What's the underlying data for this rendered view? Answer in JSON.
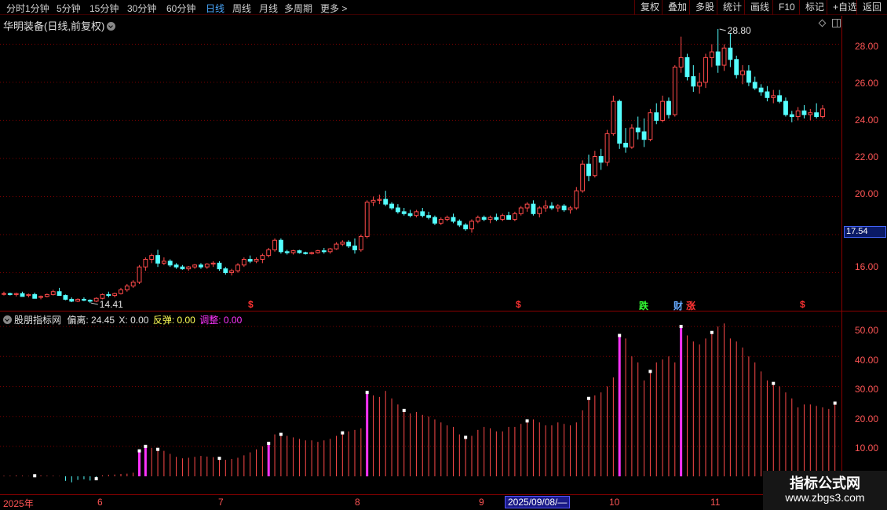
{
  "toolbar": {
    "periods": [
      "分时",
      "1分钟",
      "5分钟",
      "15分钟",
      "30分钟",
      "60分钟",
      "日线",
      "周线",
      "月线",
      "多周期",
      "更多 >"
    ],
    "active_period": "日线",
    "tools": [
      "复权",
      "叠加",
      "多股",
      "统计",
      "画线",
      "F10",
      "标记",
      "+自选",
      "返回"
    ]
  },
  "stock": {
    "title": "华明装备(日线,前复权)",
    "high_marker": "28.80",
    "low_marker": "14.41",
    "current_price": "17.54"
  },
  "price_axis": [
    "28.00",
    "26.00",
    "24.00",
    "22.00",
    "20.00",
    "16.00"
  ],
  "indicator": {
    "name": "股朋指标网",
    "deviation_label": "偏离:",
    "deviation_value": "24.45",
    "x_label": "X:",
    "x_value": "0.00",
    "rebound_label": "反弹:",
    "rebound_value": "0.00",
    "adjust_label": "调整:",
    "adjust_value": "0.00",
    "axis": [
      "50.00",
      "40.00",
      "30.00",
      "20.00",
      "10.00"
    ]
  },
  "events": {
    "dollar": "$",
    "fall": "跌",
    "finance": "财",
    "rise": "涨"
  },
  "date_axis": {
    "labels": [
      "2025年",
      "6",
      "7",
      "8",
      "9",
      "10",
      "11"
    ],
    "cursor": "2025/09/08/—"
  },
  "watermark": {
    "title": "指标公式网",
    "url": "www.zbgs3.com"
  },
  "colors": {
    "up": "#ff4a4a",
    "down": "#54ffff",
    "signal": "#ff33ff",
    "grid": "#7a0000"
  },
  "chart_data": [
    {
      "type": "candlestick",
      "title": "华明装备(日线,前复权)",
      "ylim": [
        14.0,
        29.5
      ],
      "y_ticks": [
        16,
        18,
        20,
        22,
        24,
        26,
        28
      ],
      "x_ticks": [
        "2025年",
        "6",
        "7",
        "8",
        "9",
        "10",
        "11"
      ],
      "ohlc": [
        [
          14.9,
          15.0,
          14.8,
          14.9
        ],
        [
          14.9,
          14.95,
          14.8,
          14.85
        ],
        [
          14.85,
          14.95,
          14.75,
          14.9
        ],
        [
          14.9,
          15.0,
          14.8,
          14.75
        ],
        [
          14.8,
          14.9,
          14.7,
          14.85
        ],
        [
          14.85,
          14.95,
          14.7,
          14.65
        ],
        [
          14.7,
          14.8,
          14.6,
          14.75
        ],
        [
          14.75,
          14.9,
          14.7,
          14.85
        ],
        [
          14.85,
          15.1,
          14.8,
          15.0
        ],
        [
          15.0,
          15.2,
          14.9,
          14.8
        ],
        [
          14.8,
          14.85,
          14.55,
          14.6
        ],
        [
          14.6,
          14.7,
          14.45,
          14.5
        ],
        [
          14.5,
          14.65,
          14.45,
          14.6
        ],
        [
          14.6,
          14.7,
          14.5,
          14.55
        ],
        [
          14.55,
          14.6,
          14.41,
          14.5
        ],
        [
          14.5,
          14.7,
          14.45,
          14.65
        ],
        [
          14.65,
          14.9,
          14.6,
          14.85
        ],
        [
          14.85,
          15.0,
          14.7,
          14.8
        ],
        [
          14.8,
          14.95,
          14.7,
          14.9
        ],
        [
          14.9,
          15.2,
          14.85,
          15.1
        ],
        [
          15.1,
          15.4,
          15.0,
          15.3
        ],
        [
          15.3,
          15.6,
          15.2,
          15.5
        ],
        [
          15.5,
          16.4,
          15.4,
          16.3
        ],
        [
          16.3,
          16.8,
          16.1,
          16.7
        ],
        [
          16.7,
          17.0,
          16.5,
          16.9
        ],
        [
          16.9,
          17.2,
          16.3,
          16.5
        ],
        [
          16.5,
          16.8,
          16.4,
          16.6
        ],
        [
          16.6,
          16.7,
          16.3,
          16.4
        ],
        [
          16.4,
          16.5,
          16.2,
          16.3
        ],
        [
          16.3,
          16.4,
          16.15,
          16.2
        ],
        [
          16.2,
          16.35,
          16.1,
          16.3
        ],
        [
          16.3,
          16.45,
          16.2,
          16.4
        ],
        [
          16.4,
          16.5,
          16.2,
          16.3
        ],
        [
          16.3,
          16.5,
          16.2,
          16.45
        ],
        [
          16.45,
          16.6,
          16.3,
          16.5
        ],
        [
          16.5,
          16.6,
          16.1,
          16.2
        ],
        [
          16.2,
          16.3,
          15.9,
          16.0
        ],
        [
          16.0,
          16.2,
          15.85,
          16.1
        ],
        [
          16.1,
          16.5,
          16.0,
          16.4
        ],
        [
          16.4,
          16.8,
          16.3,
          16.7
        ],
        [
          16.7,
          16.9,
          16.5,
          16.6
        ],
        [
          16.6,
          16.8,
          16.5,
          16.7
        ],
        [
          16.7,
          17.0,
          16.5,
          16.9
        ],
        [
          16.9,
          17.3,
          16.8,
          17.2
        ],
        [
          17.2,
          17.8,
          17.1,
          17.7
        ],
        [
          17.7,
          17.8,
          17.0,
          17.1
        ],
        [
          17.1,
          17.2,
          16.95,
          17.05
        ],
        [
          17.05,
          17.2,
          16.95,
          17.15
        ],
        [
          17.15,
          17.2,
          17.0,
          17.05
        ],
        [
          17.05,
          17.1,
          16.95,
          17.0
        ],
        [
          17.0,
          17.1,
          16.95,
          17.05
        ],
        [
          17.05,
          17.2,
          17.0,
          17.15
        ],
        [
          17.15,
          17.3,
          17.0,
          17.1
        ],
        [
          17.1,
          17.3,
          17.0,
          17.25
        ],
        [
          17.25,
          17.6,
          17.2,
          17.5
        ],
        [
          17.5,
          17.7,
          17.4,
          17.6
        ],
        [
          17.6,
          17.7,
          17.3,
          17.4
        ],
        [
          17.4,
          17.8,
          17.0,
          17.2
        ],
        [
          17.2,
          18.0,
          17.1,
          17.9
        ],
        [
          17.9,
          19.8,
          17.8,
          19.7
        ],
        [
          19.7,
          20.0,
          19.5,
          19.8
        ],
        [
          19.8,
          20.1,
          19.6,
          19.85
        ],
        [
          19.85,
          20.3,
          19.5,
          19.6
        ],
        [
          19.6,
          19.7,
          19.3,
          19.4
        ],
        [
          19.4,
          19.6,
          19.1,
          19.2
        ],
        [
          19.2,
          19.4,
          19.0,
          19.1
        ],
        [
          19.1,
          19.3,
          18.9,
          19.0
        ],
        [
          19.0,
          19.3,
          18.9,
          19.2
        ],
        [
          19.2,
          19.4,
          18.9,
          19.0
        ],
        [
          19.0,
          19.2,
          18.8,
          18.9
        ],
        [
          18.9,
          19.0,
          18.5,
          18.6
        ],
        [
          18.6,
          18.9,
          18.5,
          18.8
        ],
        [
          18.8,
          19.0,
          18.7,
          18.9
        ],
        [
          18.9,
          19.1,
          18.6,
          18.7
        ],
        [
          18.7,
          18.8,
          18.4,
          18.5
        ],
        [
          18.5,
          18.6,
          18.2,
          18.3
        ],
        [
          18.3,
          18.8,
          18.1,
          18.7
        ],
        [
          18.7,
          19.0,
          18.6,
          18.9
        ],
        [
          18.9,
          19.0,
          18.7,
          18.8
        ],
        [
          18.8,
          19.0,
          18.6,
          18.9
        ],
        [
          18.9,
          19.1,
          18.7,
          18.8
        ],
        [
          18.8,
          19.1,
          18.7,
          19.0
        ],
        [
          19.0,
          19.2,
          18.9,
          18.8
        ],
        [
          18.8,
          19.2,
          18.7,
          19.1
        ],
        [
          19.1,
          19.5,
          19.0,
          19.4
        ],
        [
          19.4,
          19.7,
          19.2,
          19.6
        ],
        [
          19.6,
          19.8,
          19.0,
          19.1
        ],
        [
          19.1,
          19.5,
          18.9,
          19.4
        ],
        [
          19.4,
          19.8,
          19.2,
          19.5
        ],
        [
          19.5,
          19.7,
          19.3,
          19.4
        ],
        [
          19.4,
          19.6,
          19.2,
          19.5
        ],
        [
          19.5,
          19.6,
          19.2,
          19.3
        ],
        [
          19.3,
          19.5,
          19.1,
          19.4
        ],
        [
          19.4,
          20.5,
          19.3,
          20.3
        ],
        [
          20.3,
          21.9,
          20.2,
          21.7
        ],
        [
          21.7,
          22.2,
          20.8,
          21.1
        ],
        [
          21.1,
          22.4,
          21.0,
          22.1
        ],
        [
          22.1,
          22.5,
          21.4,
          21.8
        ],
        [
          21.8,
          23.5,
          21.6,
          23.3
        ],
        [
          23.3,
          25.3,
          23.2,
          25.0
        ],
        [
          25.0,
          25.1,
          22.5,
          22.8
        ],
        [
          22.8,
          23.6,
          22.3,
          22.6
        ],
        [
          22.6,
          23.8,
          22.5,
          23.6
        ],
        [
          23.6,
          24.2,
          23.0,
          23.4
        ],
        [
          23.4,
          24.1,
          22.6,
          23.0
        ],
        [
          23.0,
          24.6,
          22.9,
          24.4
        ],
        [
          24.4,
          24.9,
          23.8,
          24.0
        ],
        [
          24.0,
          25.3,
          23.9,
          25.0
        ],
        [
          25.0,
          25.2,
          24.1,
          24.3
        ],
        [
          24.3,
          26.9,
          24.2,
          26.8
        ],
        [
          26.8,
          28.4,
          26.5,
          27.3
        ],
        [
          27.3,
          27.5,
          26.1,
          26.3
        ],
        [
          26.3,
          26.9,
          25.5,
          25.8
        ],
        [
          25.8,
          26.5,
          25.4,
          26.0
        ],
        [
          26.0,
          27.5,
          25.7,
          27.3
        ],
        [
          27.3,
          28.0,
          26.8,
          27.6
        ],
        [
          27.6,
          28.8,
          26.5,
          26.9
        ],
        [
          26.9,
          28.0,
          26.6,
          27.8
        ],
        [
          27.8,
          28.6,
          26.8,
          27.2
        ],
        [
          27.2,
          27.4,
          26.2,
          26.4
        ],
        [
          26.4,
          26.9,
          25.9,
          26.6
        ],
        [
          26.6,
          26.9,
          25.8,
          26.0
        ],
        [
          26.0,
          26.3,
          25.6,
          25.7
        ],
        [
          25.7,
          25.9,
          25.3,
          25.5
        ],
        [
          25.5,
          25.8,
          25.0,
          25.2
        ],
        [
          25.2,
          25.6,
          24.9,
          25.3
        ],
        [
          25.3,
          25.6,
          24.9,
          25.0
        ],
        [
          25.0,
          25.2,
          24.2,
          24.3
        ],
        [
          24.3,
          24.5,
          23.9,
          24.2
        ],
        [
          24.2,
          24.7,
          24.0,
          24.5
        ],
        [
          24.5,
          24.8,
          24.1,
          24.3
        ],
        [
          24.3,
          24.6,
          24.0,
          24.4
        ],
        [
          24.4,
          24.9,
          24.1,
          24.2
        ],
        [
          24.2,
          24.8,
          24.1,
          24.6
        ]
      ]
    },
    {
      "type": "bar",
      "title": "股朋指标网",
      "series": [
        {
          "name": "偏离",
          "values": [
            0.2,
            0.2,
            0.3,
            0.2,
            0.1,
            0.2,
            0.3,
            0.2,
            0.2,
            0.1,
            -1.5,
            -2.0,
            -1.2,
            -1.0,
            -1.4,
            -0.8,
            0.3,
            0.5,
            0.6,
            0.8,
            0.9,
            1.2,
            8.5,
            10.0,
            9.5,
            9.0,
            8.5,
            7.5,
            6.5,
            6.0,
            6.2,
            6.5,
            6.8,
            6.6,
            6.4,
            6.0,
            5.5,
            5.8,
            6.2,
            7.0,
            8.0,
            9.0,
            10.0,
            11.0,
            14.0,
            14.0,
            13.5,
            13.0,
            12.5,
            12.0,
            12.0,
            11.5,
            12.0,
            12.5,
            13.5,
            14.5,
            15.0,
            15.5,
            16.0,
            28.0,
            27.0,
            26.5,
            28.5,
            26.0,
            24.0,
            22.0,
            21.0,
            21.5,
            20.5,
            20.0,
            19.0,
            18.0,
            17.0,
            16.5,
            14.0,
            13.0,
            13.5,
            15.5,
            16.5,
            16.0,
            15.0,
            15.0,
            16.5,
            16.5,
            17.5,
            18.5,
            19.0,
            18.0,
            17.0,
            17.0,
            18.0,
            17.5,
            17.0,
            18.0,
            22.0,
            26.0,
            27.0,
            28.0,
            30.0,
            33.0,
            47.0,
            46.0,
            40.0,
            38.0,
            32.0,
            35.0,
            38.0,
            39.0,
            40.0,
            38.0,
            50.0,
            47.0,
            45.0,
            44.0,
            46.0,
            48.0,
            50.0,
            51.0,
            46.0,
            45.0,
            43.0,
            40.0,
            38.0,
            35.0,
            32.0,
            31.0,
            30.0,
            28.0,
            26.0,
            23.0,
            24.0,
            24.0,
            23.5,
            23.0,
            22.5,
            24.45
          ]
        }
      ],
      "markers": [
        {
          "name": "反弹",
          "x": [
            22,
            23,
            59,
            43,
            100,
            110
          ]
        },
        {
          "name": "调整",
          "x": []
        }
      ],
      "ylim": [
        -6,
        55
      ],
      "y_ticks": [
        10,
        20,
        30,
        40,
        50
      ]
    }
  ]
}
